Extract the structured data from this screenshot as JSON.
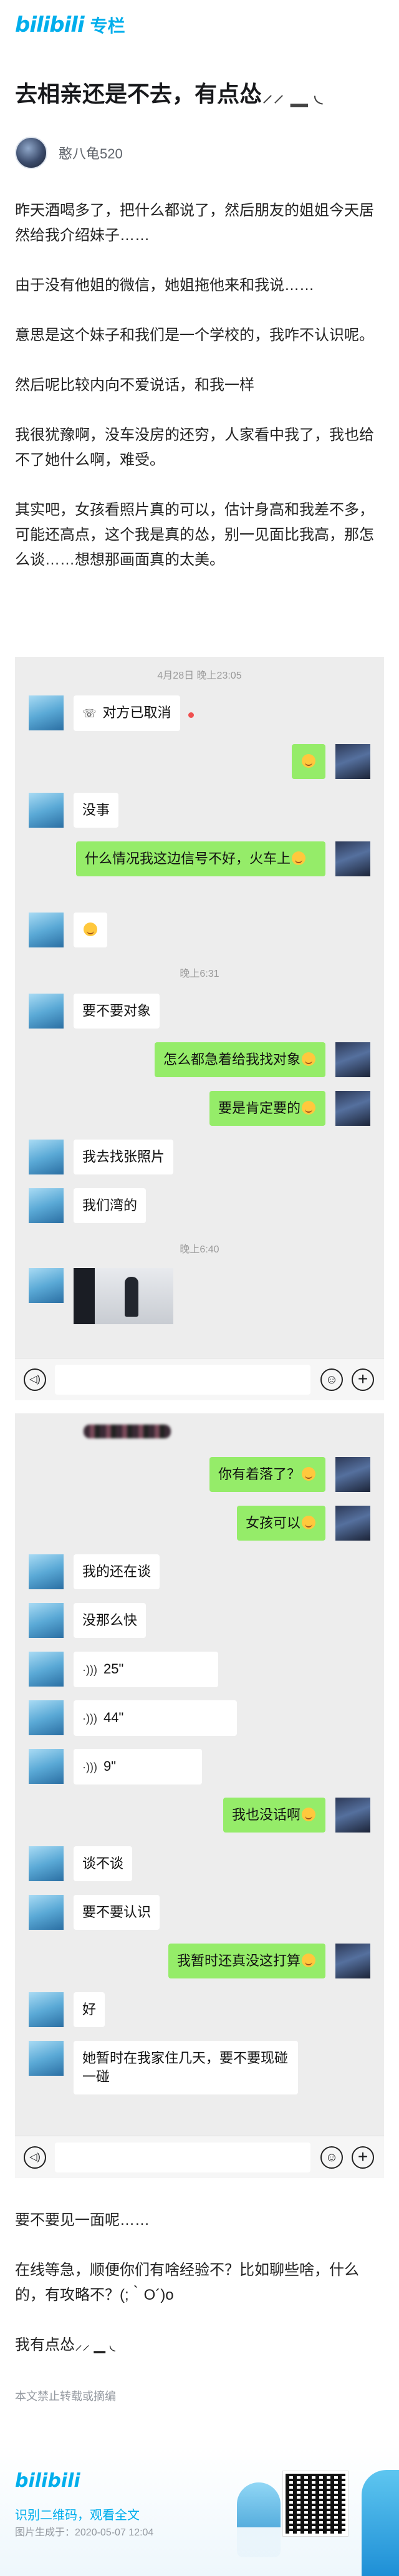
{
  "header": {
    "logo": "bilibili",
    "section": "专栏"
  },
  "article": {
    "title": "去相亲还是不去，有点怂",
    "title_deco": "⸝⸝ ▁ ◟",
    "author": "憨八龟520",
    "paragraphs": [
      "昨天酒喝多了，把什么都说了，然后朋友的姐姐今天居然给我介绍妹子……",
      "由于没有他姐的微信，她姐拖他来和我说……",
      "意思是这个妹子和我们是一个学校的，我咋不认识呢。",
      "然后呢比较内向不爱说话，和我一样",
      "我很犹豫啊，没车没房的还穷，人家看中我了，我也给不了她什么啊，难受。",
      "其实吧，女孩看照片真的可以，估计身高和我差不多，可能还高点，这个我是真的怂，别一见面比我高，那怎么谈……想想那画面真的太美。"
    ],
    "closing": [
      "要不要见一面呢……",
      "在线等急，顺便你们有啥经验不？比如聊些啥，什么的，有攻略不？(;｀O´)o",
      "我有点怂⸝⸝ ▁ ◟"
    ],
    "notice": "本文禁止转载或摘编"
  },
  "chat1": {
    "timestamps": [
      "4月28日 晚上23:05",
      "晚上6:31",
      "晚上6:40"
    ],
    "messages": [
      {
        "side": "left",
        "text": "对方已取消",
        "call": true
      },
      {
        "side": "right",
        "text": "",
        "emoji": true
      },
      {
        "side": "left",
        "text": "没事"
      },
      {
        "side": "right",
        "text": "什么情况我这边信号不好，火车上"
      },
      {
        "side": "left",
        "text": "",
        "emoji": true
      },
      {
        "side": "left",
        "text": "要不要对象"
      },
      {
        "side": "right",
        "text": "怎么都急着给我找对象"
      },
      {
        "side": "right",
        "text": "要是肯定要的"
      },
      {
        "side": "left",
        "text": "我去找张照片"
      },
      {
        "side": "left",
        "text": "我们湾的"
      }
    ]
  },
  "chat2": {
    "messages": [
      {
        "side": "right",
        "text": "你有着落了？"
      },
      {
        "side": "right",
        "text": "女孩可以"
      },
      {
        "side": "left",
        "text": "我的还在谈"
      },
      {
        "side": "left",
        "text": "没那么快"
      },
      {
        "side": "left",
        "text": "25\"",
        "voice": true
      },
      {
        "side": "left",
        "text": "44\"",
        "voice": true
      },
      {
        "side": "left",
        "text": "9\"",
        "voice": true
      },
      {
        "side": "right",
        "text": "我也没话啊"
      },
      {
        "side": "left",
        "text": "谈不谈"
      },
      {
        "side": "left",
        "text": "要不要认识"
      },
      {
        "side": "right",
        "text": "我暂时还真没这打算"
      },
      {
        "side": "left",
        "text": "好"
      },
      {
        "side": "left",
        "text": "她暂时在我家住几天，要不要现碰一碰"
      }
    ]
  },
  "footer": {
    "logo": "bilibili",
    "line1": "识别二维码，观看全文",
    "line2": "图片生成于：2020-05-07 12:04"
  },
  "colors": {
    "brand": "#00aeec",
    "bubble_self": "#95ec69",
    "chat_bg": "#ededed"
  }
}
